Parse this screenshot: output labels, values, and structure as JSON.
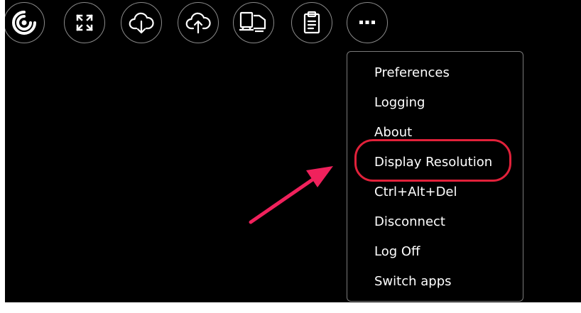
{
  "toolbar": {
    "buttons": [
      {
        "name": "citrix-logo-icon"
      },
      {
        "name": "fullscreen-icon"
      },
      {
        "name": "cloud-download-icon"
      },
      {
        "name": "cloud-upload-icon"
      },
      {
        "name": "multi-monitor-icon"
      },
      {
        "name": "clipboard-icon"
      },
      {
        "name": "more-options-icon"
      }
    ]
  },
  "menu": {
    "items": [
      {
        "label": "Preferences"
      },
      {
        "label": "Logging"
      },
      {
        "label": "About"
      },
      {
        "label": "Display Resolution",
        "highlighted": true
      },
      {
        "label": "Ctrl+Alt+Del"
      },
      {
        "label": "Disconnect"
      },
      {
        "label": "Log Off"
      },
      {
        "label": "Switch apps"
      }
    ]
  },
  "annotation": {
    "highlight_color": "#e1213a",
    "arrow_color": "#f0215c"
  },
  "colors": {
    "background": "#000000",
    "text": "#ffffff",
    "button_border": "#8a8a8a"
  }
}
